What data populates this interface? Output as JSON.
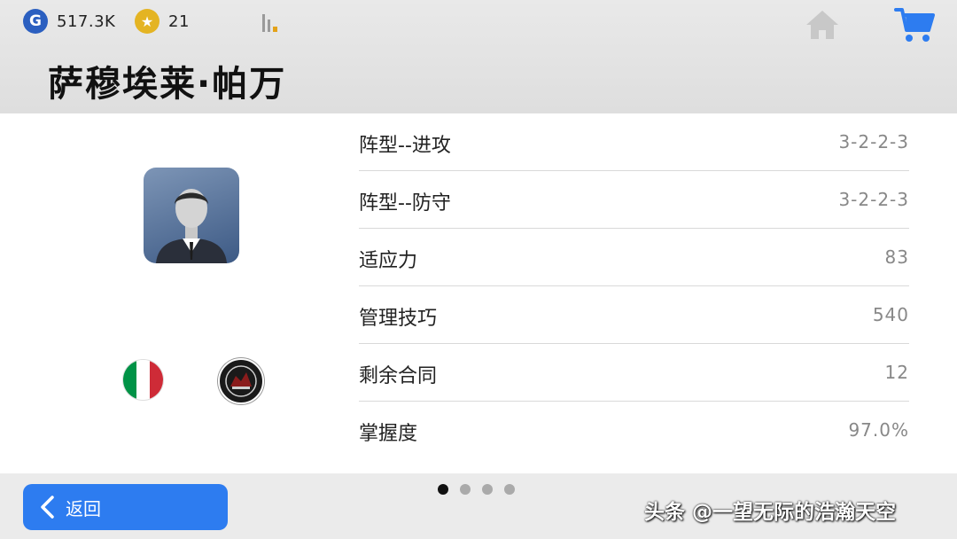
{
  "header": {
    "gp": {
      "icon": "g-points-icon",
      "symbol": "G",
      "value": "517.3K"
    },
    "coins": {
      "icon": "coin-icon",
      "symbol": "★",
      "value": "21"
    },
    "signal_icon": "signal-icon",
    "home_icon": "home-icon",
    "cart_icon": "cart-icon",
    "title": "萨穆埃莱·帕万"
  },
  "manager": {
    "avatar_icon": "manager-avatar",
    "nationality_flag": "italy-flag-icon",
    "club_logo": "club-logo-icon"
  },
  "stats": [
    {
      "label": "阵型--进攻",
      "value": "3-2-2-3"
    },
    {
      "label": "阵型--防守",
      "value": "3-2-2-3"
    },
    {
      "label": "适应力",
      "value": "83"
    },
    {
      "label": "管理技巧",
      "value": "540"
    },
    {
      "label": "剩余合同",
      "value": "12"
    },
    {
      "label": "掌握度",
      "value": "97.0%"
    }
  ],
  "footer": {
    "back_label": "返回",
    "back_icon": "chevron-left-icon",
    "pages_total": 4,
    "page_current": 1,
    "watermark": "头条 @一望无际的浩瀚天空"
  },
  "colors": {
    "accent": "#2d7cf0",
    "gp_blue": "#2b5fc0",
    "coin_gold": "#e4b423",
    "flag_green": "#009246",
    "flag_white": "#ffffff",
    "flag_red": "#ce2b37"
  }
}
